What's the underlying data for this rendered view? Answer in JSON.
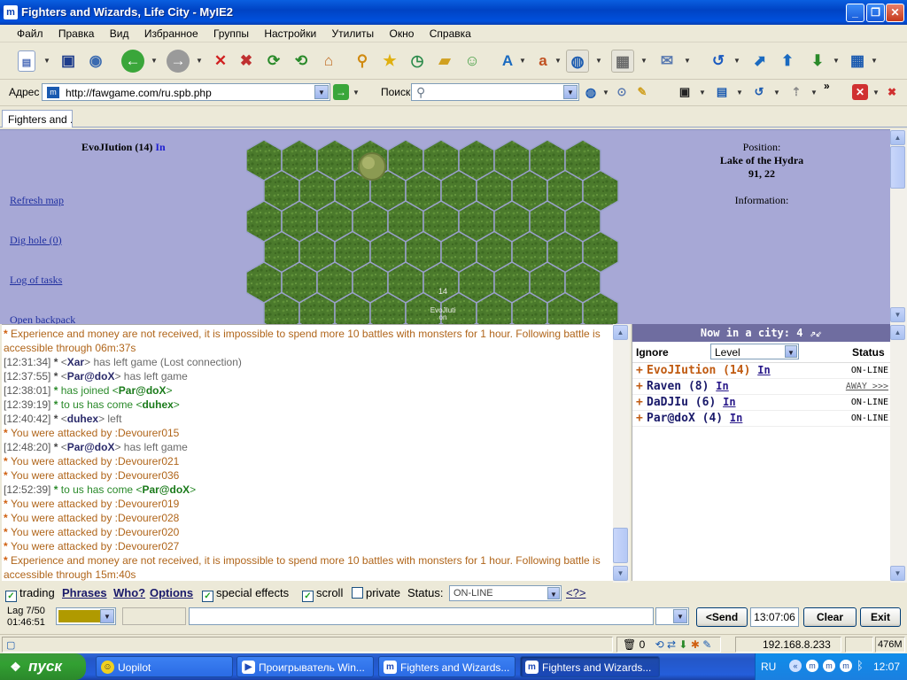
{
  "window": {
    "title": "Fighters and Wizards, Life City - MyIE2"
  },
  "menu": [
    "Файл",
    "Правка",
    "Вид",
    "Избранное",
    "Группы",
    "Настройки",
    "Утилиты",
    "Окно",
    "Справка"
  ],
  "address": {
    "label": "Адрес",
    "url": "http://fawgame.com/ru.spb.php",
    "search_label": "Поиск",
    "search_value": ""
  },
  "tab": {
    "label": "Fighters and ..."
  },
  "game": {
    "player_name": "EvoJIution (14)",
    "player_in": "In",
    "links": [
      "Refresh map",
      "Dig hole (0)",
      "Log of tasks",
      "Open backpack"
    ],
    "position_label": "Position:",
    "location": "Lake of the Hydra",
    "coords": "91, 22",
    "information_label": "Information:",
    "map_number": "14",
    "map_name_line1": "EvoJIuti",
    "map_name_line2": "on"
  },
  "chat": {
    "lines": [
      {
        "kind": "sys",
        "ts": "",
        "parts": [
          {
            "t": "Experience and money are not received, it is impossible to spend more 10 battles with monsters for 1 hour. Following battle is accessible through 06m:37s",
            "c": "sys"
          }
        ],
        "wrap": true
      },
      {
        "kind": "normal",
        "ts": "[12:31:34]",
        "parts": [
          {
            "t": "<",
            "c": "mt"
          },
          {
            "t": "Xar",
            "c": "un"
          },
          {
            "t": "> has left game (Lost connection)",
            "c": "mt"
          }
        ]
      },
      {
        "kind": "normal",
        "ts": "[12:37:55]",
        "parts": [
          {
            "t": "<",
            "c": "mt"
          },
          {
            "t": "Par@doX",
            "c": "un"
          },
          {
            "t": "> has left game",
            "c": "mt"
          }
        ]
      },
      {
        "kind": "join",
        "ts": "[12:38:01]",
        "parts": [
          {
            "t": "has joined <",
            "c": "jn"
          },
          {
            "t": "Par@doX",
            "c": "ung"
          },
          {
            "t": ">",
            "c": "jn"
          }
        ]
      },
      {
        "kind": "join",
        "ts": "[12:39:19]",
        "parts": [
          {
            "t": "to us has come <",
            "c": "jn"
          },
          {
            "t": "duhex",
            "c": "ung"
          },
          {
            "t": ">",
            "c": "jn"
          }
        ]
      },
      {
        "kind": "normal",
        "ts": "[12:40:42]",
        "parts": [
          {
            "t": "<",
            "c": "mt"
          },
          {
            "t": "duhex",
            "c": "un"
          },
          {
            "t": "> left",
            "c": "mt"
          }
        ]
      },
      {
        "kind": "sys",
        "ts": "",
        "parts": [
          {
            "t": "You were attacked by :Devourer015",
            "c": "sys"
          }
        ]
      },
      {
        "kind": "normal",
        "ts": "[12:48:20]",
        "parts": [
          {
            "t": "<",
            "c": "mt"
          },
          {
            "t": "Par@doX",
            "c": "un"
          },
          {
            "t": "> has left game",
            "c": "mt"
          }
        ]
      },
      {
        "kind": "sys",
        "ts": "",
        "parts": [
          {
            "t": "You were attacked by :Devourer021",
            "c": "sys"
          }
        ]
      },
      {
        "kind": "sys",
        "ts": "",
        "parts": [
          {
            "t": "You were attacked by :Devourer036",
            "c": "sys"
          }
        ]
      },
      {
        "kind": "join",
        "ts": "[12:52:39]",
        "parts": [
          {
            "t": "to us has come <",
            "c": "jn"
          },
          {
            "t": "Par@doX",
            "c": "ung"
          },
          {
            "t": ">",
            "c": "jn"
          }
        ]
      },
      {
        "kind": "sys",
        "ts": "",
        "parts": [
          {
            "t": "You were attacked by :Devourer019",
            "c": "sys"
          }
        ]
      },
      {
        "kind": "sys",
        "ts": "",
        "parts": [
          {
            "t": "You were attacked by :Devourer028",
            "c": "sys"
          }
        ]
      },
      {
        "kind": "sys",
        "ts": "",
        "parts": [
          {
            "t": "You were attacked by :Devourer020",
            "c": "sys"
          }
        ]
      },
      {
        "kind": "sys",
        "ts": "",
        "parts": [
          {
            "t": "You were attacked by :Devourer027",
            "c": "sys"
          }
        ]
      },
      {
        "kind": "sys",
        "ts": "",
        "parts": [
          {
            "t": "Experience and money are not received, it is impossible to spend more 10 battles with monsters for 1 hour. Following battle is accessible through 15m:40s",
            "c": "sys"
          }
        ],
        "wrap": true
      }
    ]
  },
  "people": {
    "header": "Now in a city: 4",
    "col_ignore": "Ignore",
    "sort_value": "Level",
    "col_status": "Status",
    "rows": [
      {
        "name": "EvoJIution (14)",
        "in": "In",
        "status": "ON-LINE",
        "color": "#c05a10"
      },
      {
        "name": "Raven (8)",
        "in": "In",
        "status": "AWAY >>>",
        "color": "#1a1a6a"
      },
      {
        "name": "DaDJIu (6)",
        "in": "In",
        "status": "ON-LINE",
        "color": "#1a1a6a"
      },
      {
        "name": "Par@doX (4)",
        "in": "In",
        "status": "ON-LINE",
        "color": "#1a1a6a"
      }
    ]
  },
  "options": {
    "trading": "trading",
    "phrases": "Phrases",
    "who": "Who?",
    "options": "Options",
    "special_effects": "special effects",
    "scroll": "scroll",
    "private": "private",
    "status_label": "Status:",
    "status_value": "ON-LINE",
    "help": "<?>"
  },
  "input": {
    "lag": "Lag 7/50",
    "timer": "01:46:51",
    "send": "<Send",
    "clock": "13:07:06",
    "clear": "Clear",
    "exit": "Exit",
    "message": ""
  },
  "status": {
    "zero": "0",
    "ip": "192.168.8.233",
    "memory": "476M"
  },
  "taskbar": {
    "start": "пуск",
    "tasks": [
      "Uopilot",
      "Проигрыватель Win...",
      "Fighters and Wizards...",
      "Fighters and Wizards..."
    ],
    "lang": "RU",
    "time": "12:07"
  },
  "colors": {
    "game_bg": "#a7a8d6",
    "header_bg": "#6f6da0",
    "accent": "#0a5fe0"
  }
}
